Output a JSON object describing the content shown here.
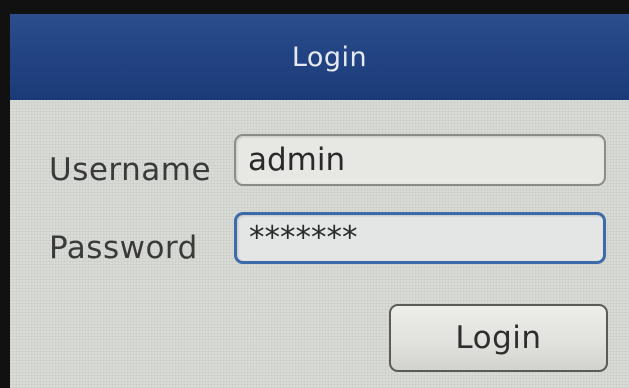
{
  "window": {
    "title": "Login"
  },
  "form": {
    "username_label": "Username",
    "username_value": "admin",
    "password_label": "Password",
    "password_value": "*******",
    "submit_label": "Login"
  },
  "colors": {
    "title_bar": "#234483",
    "panel_background": "#d9dcd6",
    "focused_field_border": "#3d6aa8"
  }
}
